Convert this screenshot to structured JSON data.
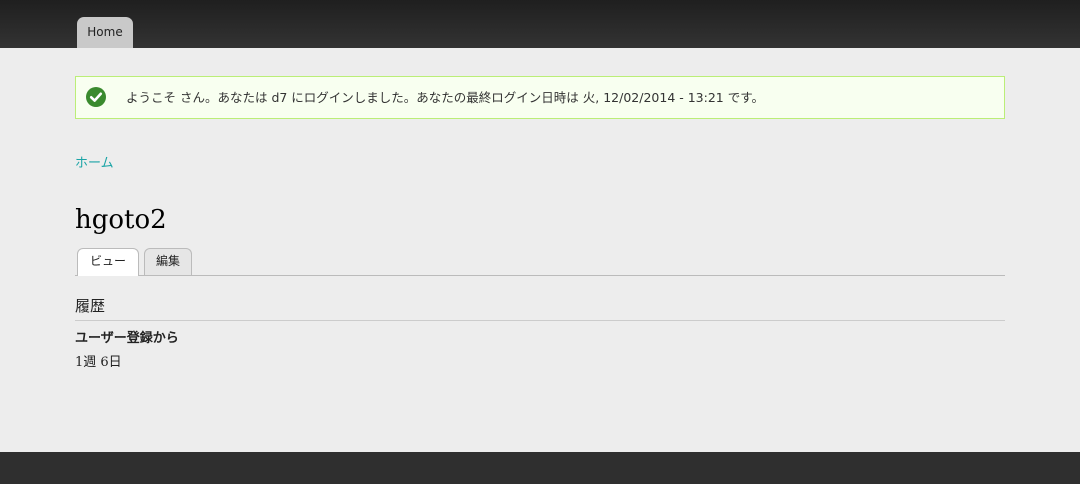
{
  "header": {
    "home_tab": "Home"
  },
  "status": {
    "message": "ようこそ さん。あなたは d7 にログインしました。あなたの最終ログイン日時は 火, 12/02/2014 - 13:21 です。",
    "color": "#3a8a2e"
  },
  "breadcrumb": {
    "home": "ホーム"
  },
  "page": {
    "title": "hgoto2"
  },
  "tabs": [
    {
      "label": "ビュー",
      "active": true
    },
    {
      "label": "編集",
      "active": false
    }
  ],
  "history": {
    "heading": "履歴",
    "member_for_label": "ユーザー登録から",
    "member_for_value": "1週 6日"
  },
  "colors": {
    "link": "#1ba4a6",
    "background": "#ededed",
    "header": "#2b2b2b"
  }
}
